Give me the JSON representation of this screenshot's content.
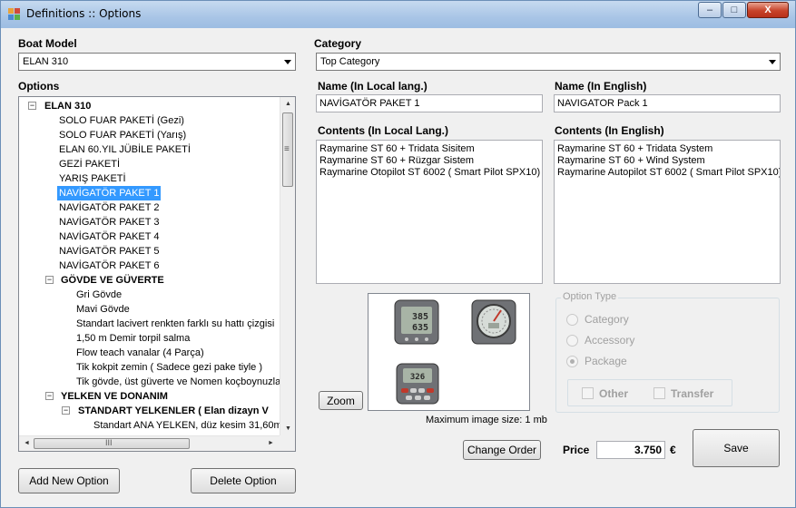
{
  "window": {
    "title": "Definitions :: Options",
    "minimize_glyph": "–",
    "maximize_glyph": "□",
    "close_glyph": "X"
  },
  "boat_model": {
    "label": "Boat Model",
    "value": "ELAN 310"
  },
  "category": {
    "label": "Category",
    "value": "Top Category"
  },
  "options_label": "Options",
  "tree": [
    {
      "text": "ELAN 310",
      "level": 0,
      "bold": true,
      "expander": "−"
    },
    {
      "text": "SOLO FUAR PAKETİ (Gezi)",
      "level": 1
    },
    {
      "text": "SOLO FUAR PAKETİ (Yarış)",
      "level": 1
    },
    {
      "text": "ELAN 60.YIL JÜBİLE PAKETİ",
      "level": 1
    },
    {
      "text": "GEZİ PAKETİ",
      "level": 1
    },
    {
      "text": "YARIŞ PAKETİ",
      "level": 1
    },
    {
      "text": "NAVİGATÖR PAKET 1",
      "level": 1,
      "selected": true
    },
    {
      "text": "NAVİGATÖR PAKET 2",
      "level": 1
    },
    {
      "text": "NAVİGATÖR PAKET 3",
      "level": 1
    },
    {
      "text": "NAVİGATÖR PAKET 4",
      "level": 1
    },
    {
      "text": "NAVİGATÖR PAKET 5",
      "level": 1
    },
    {
      "text": "NAVİGATÖR PAKET 6",
      "level": 1
    },
    {
      "text": "GÖVDE VE GÜVERTE",
      "level": 1,
      "bold": true,
      "expander": "−"
    },
    {
      "text": "Gri Gövde",
      "level": 2
    },
    {
      "text": "Mavi Gövde",
      "level": 2
    },
    {
      "text": "Standart lacivert renkten farklı su hattı çizgisi",
      "level": 2
    },
    {
      "text": "1,50 m Demir torpil salma",
      "level": 2
    },
    {
      "text": "Flow teach vanalar (4 Parça)",
      "level": 2
    },
    {
      "text": "Tik kokpit zemin ( Sadece gezi pake tiyle )",
      "level": 2
    },
    {
      "text": "Tik gövde, üst güverte ve Nomen koçboynuzları",
      "level": 2
    },
    {
      "text": "YELKEN VE DONANIM",
      "level": 1,
      "bold": true,
      "expander": "−"
    },
    {
      "text": "STANDART YELKENLER ( Elan dizayn  V",
      "level": 2,
      "bold": true,
      "expander": "−"
    },
    {
      "text": "Standart ANA YELKEN, düz kesim   31,60m2",
      "level": 3
    },
    {
      "text": "Furling CENOVA 112% düz kesim  26,00m",
      "level": 3
    }
  ],
  "name_local": {
    "label": "Name (In Local lang.)",
    "value": "NAVİGATÖR PAKET 1"
  },
  "name_english": {
    "label": "Name (In English)",
    "value": "NAVIGATOR Pack 1"
  },
  "contents_local": {
    "label": "Contents (In Local Lang.)",
    "value": "Raymarine ST 60 + Tridata Sisitem\nRaymarine ST 60 + Rüzgar Sistem\nRaymarine Otopilot ST 6002 ( Smart Pilot SPX10)"
  },
  "contents_english": {
    "label": "Contents (In English)",
    "value": "Raymarine ST 60 + Tridata System\nRaymarine ST 60 + Wind System\nRaymarine Autopilot ST 6002 ( Smart Pilot SPX10)"
  },
  "image": {
    "instruments": {
      "tridata_top": "385",
      "tridata_bottom": "635",
      "autopilot_display": "326"
    },
    "max_size_note": "Maximum image size: 1 mb",
    "zoom_label": "Zoom"
  },
  "option_type": {
    "legend": "Option Type",
    "radios": [
      {
        "label": "Category",
        "checked": false
      },
      {
        "label": "Accessory",
        "checked": false
      },
      {
        "label": "Package",
        "checked": true
      }
    ],
    "checks": [
      {
        "label": "Other",
        "checked": false
      },
      {
        "label": "Transfer",
        "checked": false
      }
    ]
  },
  "buttons": {
    "add_new_option": "Add New Option",
    "delete_option": "Delete Option",
    "change_order": "Change Order",
    "save": "Save"
  },
  "price": {
    "label": "Price",
    "value": "3.750",
    "currency": "€"
  },
  "scrollbar_glyphs": {
    "up": "▲",
    "down": "▼",
    "left": "◄",
    "right": "►",
    "grip_v": "≡",
    "grip_h": "III"
  },
  "colors": {
    "selection": "#3399ff",
    "titlebar": "#a9c5e6",
    "disabled_text": "#a0a0a0"
  }
}
